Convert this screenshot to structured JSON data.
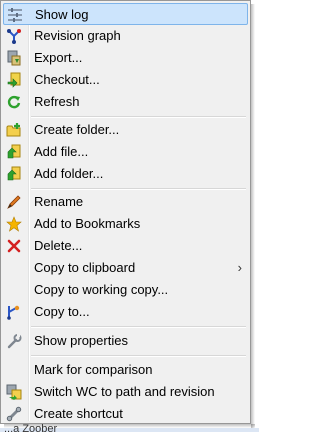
{
  "menu": {
    "items": [
      {
        "label": "Show log",
        "icon": "show-log-icon"
      },
      {
        "label": "Revision graph",
        "icon": "revision-graph-icon"
      },
      {
        "label": "Export...",
        "icon": "export-icon"
      },
      {
        "label": "Checkout...",
        "icon": "checkout-icon"
      },
      {
        "label": "Refresh",
        "icon": "refresh-icon"
      },
      {
        "label": "Create folder...",
        "icon": "create-folder-icon"
      },
      {
        "label": "Add file...",
        "icon": "add-file-icon"
      },
      {
        "label": "Add folder...",
        "icon": "add-folder-icon"
      },
      {
        "label": "Rename",
        "icon": "rename-icon"
      },
      {
        "label": "Add to Bookmarks",
        "icon": "bookmark-star-icon"
      },
      {
        "label": "Delete...",
        "icon": "delete-icon"
      },
      {
        "label": "Copy to clipboard",
        "icon": "",
        "submenu_arrow": "›"
      },
      {
        "label": "Copy to working copy...",
        "icon": ""
      },
      {
        "label": "Copy to...",
        "icon": "copy-to-icon"
      },
      {
        "label": "Show properties",
        "icon": "properties-wrench-icon"
      },
      {
        "label": "Mark for comparison",
        "icon": ""
      },
      {
        "label": "Switch WC to path and revision",
        "icon": "switch-icon"
      },
      {
        "label": "Create shortcut",
        "icon": "shortcut-icon"
      }
    ]
  },
  "behind_text": "...a Zoober",
  "colors": {
    "highlight": "#cce4fc",
    "highlight_border": "#7eb4ea",
    "menu_bg": "#f0f0f0"
  }
}
